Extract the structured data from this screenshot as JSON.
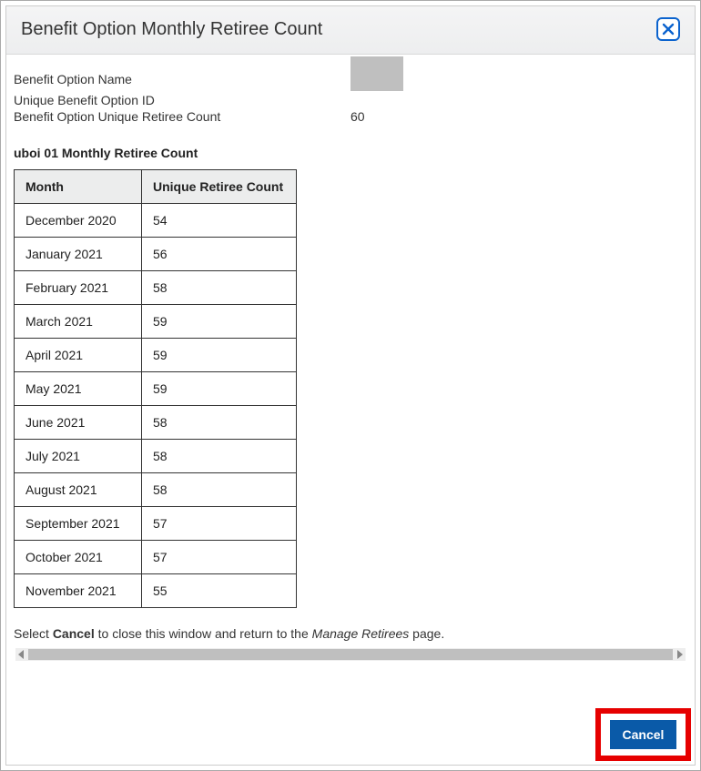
{
  "header": {
    "title": "Benefit Option Monthly Retiree Count"
  },
  "info": {
    "name_label": "Benefit Option Name",
    "name_value": "",
    "id_label": "Unique Benefit Option ID",
    "id_value": "",
    "count_label": "Benefit Option Unique Retiree Count",
    "count_value": "60"
  },
  "subheading": "uboi 01 Monthly Retiree Count",
  "table": {
    "headers": {
      "month": "Month",
      "count": "Unique Retiree Count"
    },
    "rows": [
      {
        "month": "December 2020",
        "count": "54"
      },
      {
        "month": "January 2021",
        "count": "56"
      },
      {
        "month": "February 2021",
        "count": "58"
      },
      {
        "month": "March 2021",
        "count": "59"
      },
      {
        "month": "April 2021",
        "count": "59"
      },
      {
        "month": "May 2021",
        "count": "59"
      },
      {
        "month": "June 2021",
        "count": "58"
      },
      {
        "month": "July 2021",
        "count": "58"
      },
      {
        "month": "August 2021",
        "count": "58"
      },
      {
        "month": "September 2021",
        "count": "57"
      },
      {
        "month": "October 2021",
        "count": "57"
      },
      {
        "month": "November 2021",
        "count": "55"
      }
    ]
  },
  "instruction": {
    "pre": "Select ",
    "bold": "Cancel",
    "mid": " to close this window and return to the ",
    "italic": "Manage Retirees",
    "post": " page."
  },
  "buttons": {
    "cancel": "Cancel"
  }
}
